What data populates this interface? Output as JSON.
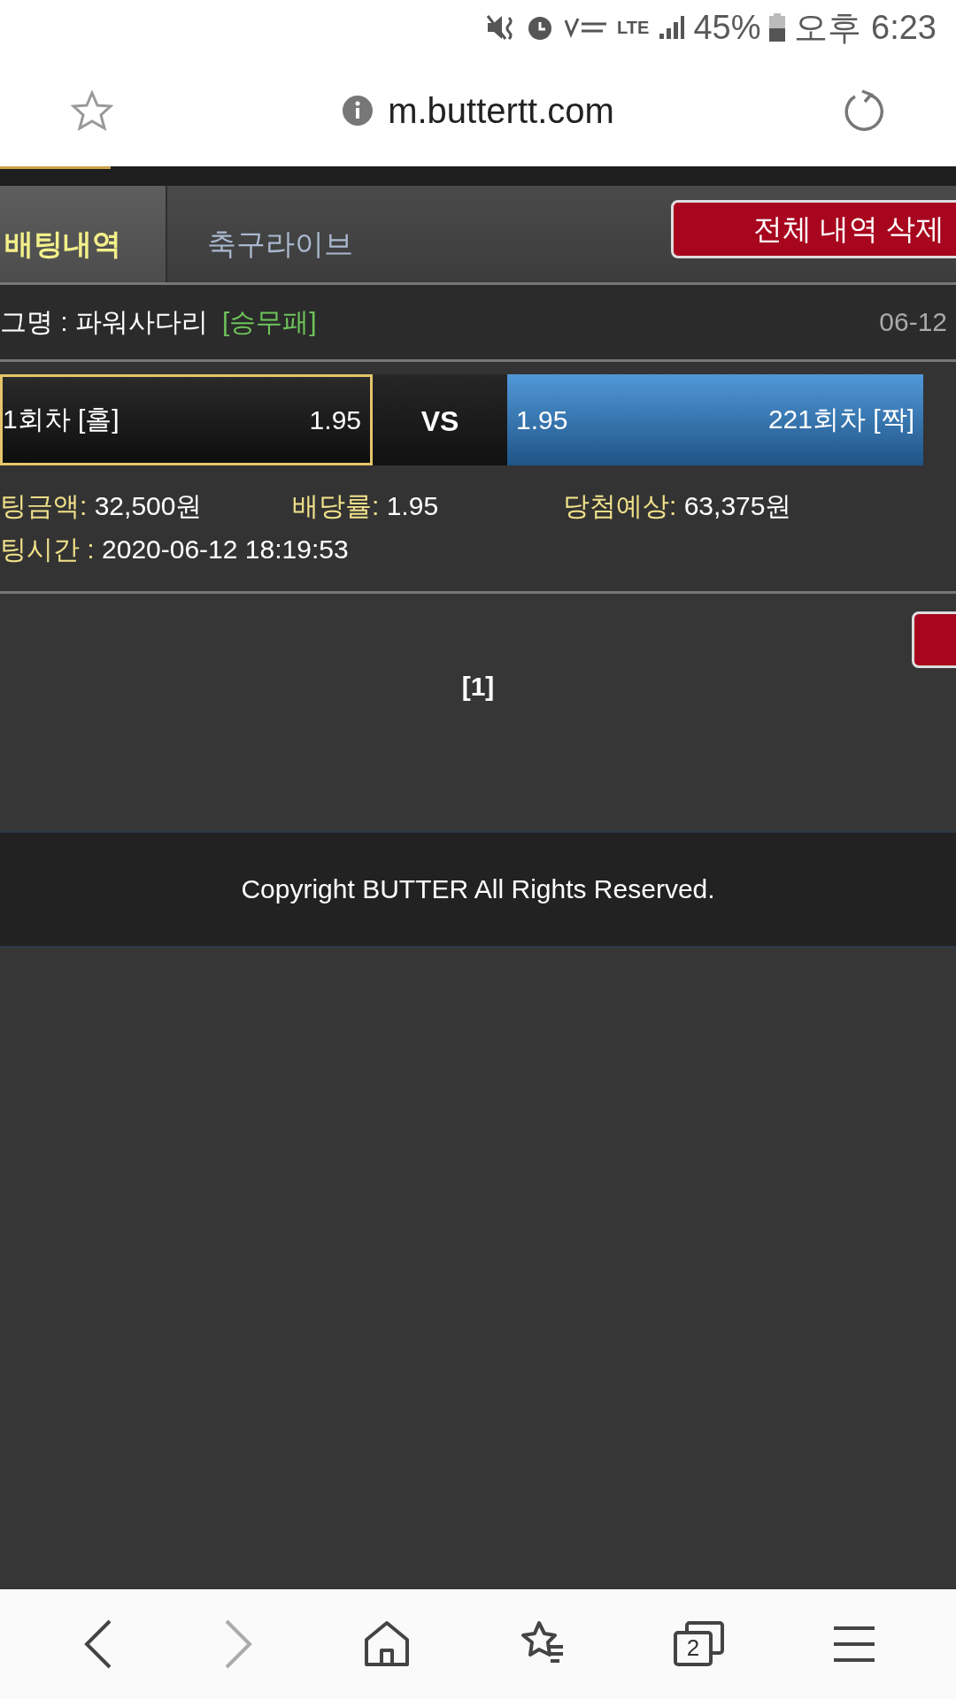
{
  "status_bar": {
    "network": "LTE",
    "battery": "45%",
    "time": "오후 6:23"
  },
  "browser": {
    "url": "m.buttertt.com"
  },
  "tabs": [
    {
      "label": "배팅내역",
      "selected": true
    },
    {
      "label": "축구라이브",
      "selected": false
    }
  ],
  "delete_all_button": "전체 내역 삭제",
  "bet": {
    "league": "그명 : 파워사다리",
    "market": "[승무패]",
    "date": "06-12",
    "picks": [
      {
        "label": "1회차 [홀]",
        "odds": "1.95",
        "selected": false
      },
      {
        "label": "221회차 [짝]",
        "odds": "1.95",
        "selected": true
      }
    ],
    "vs": "VS",
    "details": [
      {
        "label": "팅금액:",
        "value": "32,500원"
      },
      {
        "label": "배당률:",
        "value": "1.95"
      },
      {
        "label": "당첨예상:",
        "value": "63,375원"
      }
    ],
    "time": {
      "label": "팅시간 :",
      "value": "2020-06-12 18:19:53"
    }
  },
  "pagination": [
    {
      "label": "[1]",
      "selected": true
    }
  ],
  "footer": "Copyright BUTTER All Rights Reserved.",
  "nav": {
    "forward_disabled": true,
    "tab_count": "2"
  }
}
